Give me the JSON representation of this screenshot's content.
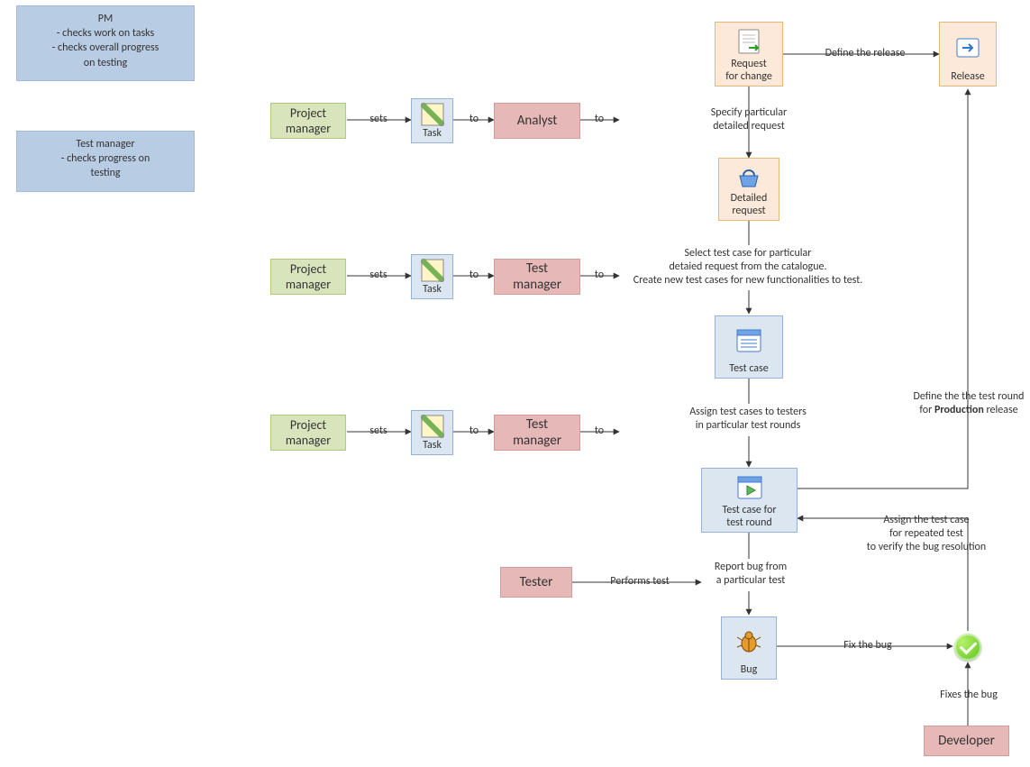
{
  "notes": {
    "pm_title": "PM",
    "pm_line1": "- checks work on tasks",
    "pm_line2": "- checks overall progress",
    "pm_line3": "on testing",
    "tm_title": "Test manager",
    "tm_line1": "- checks progress on",
    "tm_line2": "testing"
  },
  "roles": {
    "project_manager": "Project\nmanager",
    "analyst": "Analyst",
    "test_manager": "Test\nmanager",
    "tester": "Tester",
    "developer": "Developer"
  },
  "objects": {
    "task": "Task",
    "request_for_change": "Request\nfor change",
    "release": "Release",
    "detailed_request": "Detailed\nrequest",
    "test_case": "Test case",
    "test_case_for_round": "Test case for\ntest round",
    "bug": "Bug"
  },
  "edges": {
    "sets": "sets",
    "to": "to",
    "performs_test": "Performs test",
    "define_release": "Define the release",
    "specify_detailed": "Specify particular\ndetailed request",
    "select_catalogue": "Select test case for particular\ndetaied request from the catalogue.\nCreate new test cases for new functionalities to test.",
    "assign_to_testers": "Assign test cases to testers\nin particular test rounds",
    "report_bug": "Report bug from\na particular test",
    "fix_the_bug": "Fix the bug",
    "fixes_the_bug": "Fixes the bug",
    "assign_repeated": "Assign the test case\nfor repeated test\nto verify the bug resolution",
    "define_prod_before": "Define the the test round\nfor ",
    "define_prod_bold": "Production",
    "define_prod_after": " release"
  }
}
